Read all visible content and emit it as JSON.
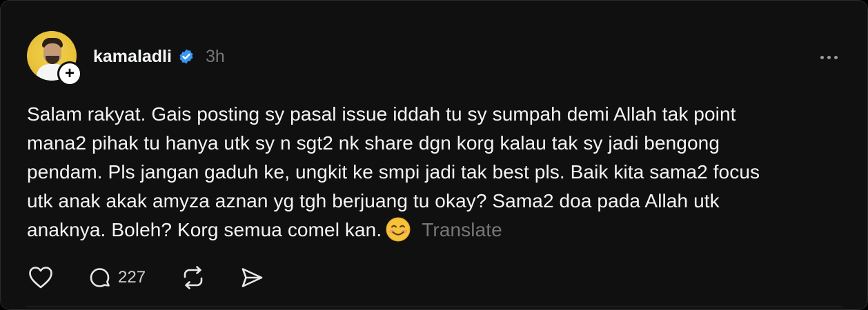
{
  "post": {
    "username": "kamaladli",
    "timestamp": "3h",
    "follow_symbol": "+",
    "lines": [
      "Salam rakyat. Gais posting sy pasal issue iddah tu sy sumpah demi Allah tak point",
      "mana2 pihak tu hanya utk sy n sgt2 nk share dgn korg kalau tak sy jadi bengong",
      "pendam. Pls jangan gaduh ke, ungkit ke smpi jadi tak best pls. Baik kita sama2 focus",
      "utk anak akak amyza aznan yg tgh berjuang tu okay? Sama2 doa pada Allah utk",
      "anaknya. Boleh? Korg semua comel kan."
    ],
    "emoji": "smiling-face-icon",
    "translate_label": "Translate",
    "reply_count": "227",
    "verified_color": "#3897f0",
    "text_color": "#f3f5f7",
    "muted_color": "#777777"
  }
}
